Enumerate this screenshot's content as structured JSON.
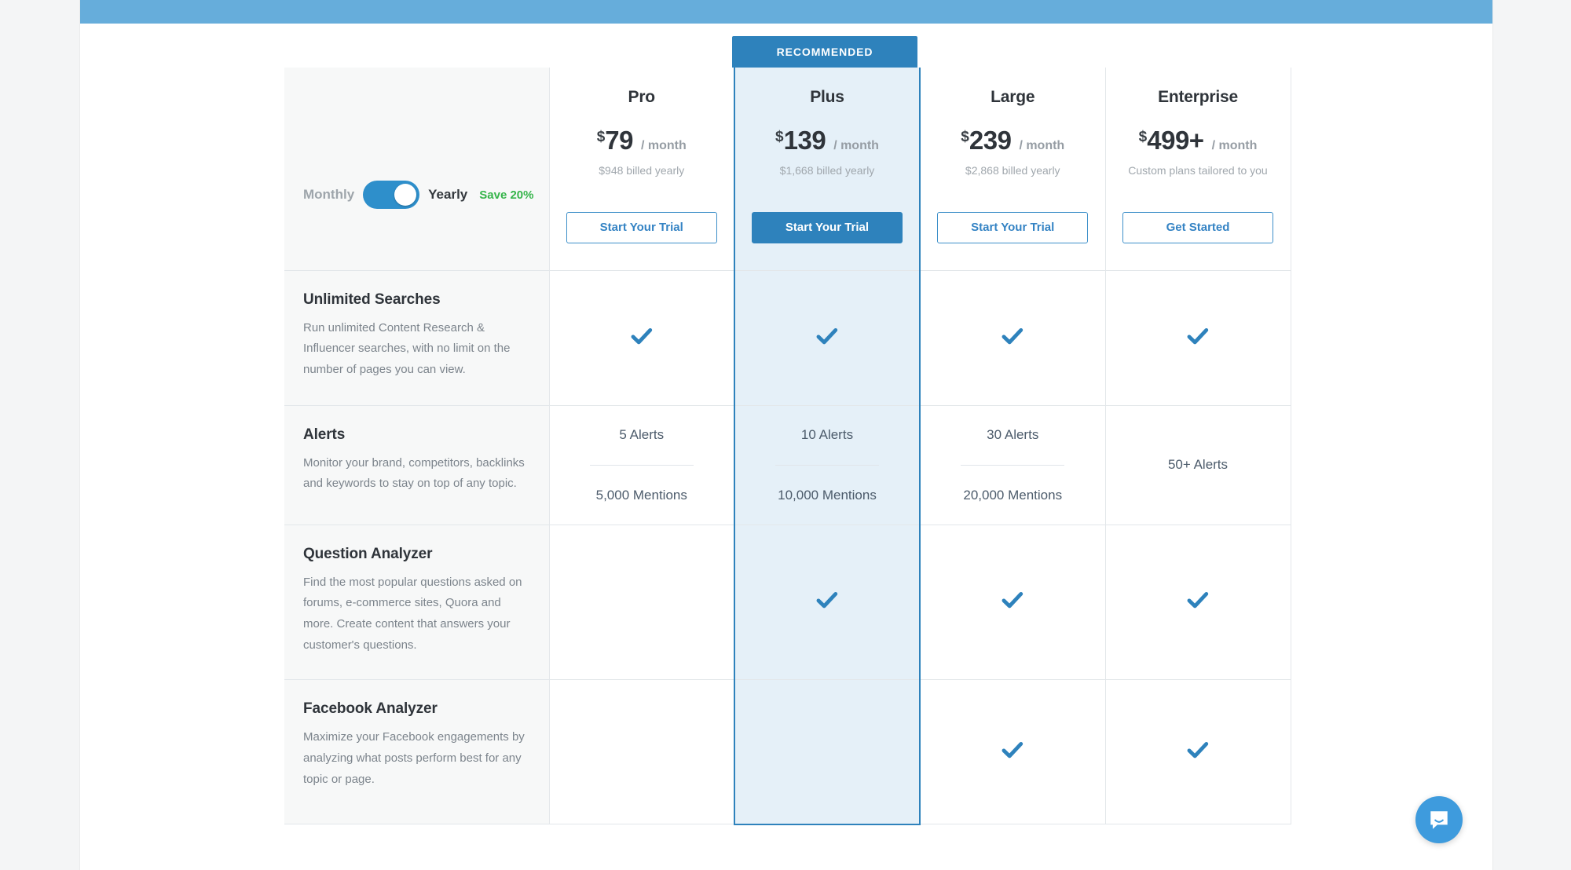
{
  "theme": {
    "top_bar_color": "#66ADDB",
    "accent_color": "#2E82BC",
    "highlight_bg": "#e5f0f8",
    "save_color": "#35b44a"
  },
  "billing_toggle": {
    "monthly_label": "Monthly",
    "yearly_label": "Yearly",
    "save_label": "Save 20%",
    "selected": "Yearly"
  },
  "recommended_badge": "RECOMMENDED",
  "plans": [
    {
      "name": "Pro",
      "currency": "$",
      "amount": "79",
      "period": "/ month",
      "billed": "$948 billed yearly",
      "cta": "Start Your Trial",
      "recommended": false
    },
    {
      "name": "Plus",
      "currency": "$",
      "amount": "139",
      "period": "/ month",
      "billed": "$1,668 billed yearly",
      "cta": "Start Your Trial",
      "recommended": true
    },
    {
      "name": "Large",
      "currency": "$",
      "amount": "239",
      "period": "/ month",
      "billed": "$2,868 billed yearly",
      "cta": "Start Your Trial",
      "recommended": false
    },
    {
      "name": "Enterprise",
      "currency": "$",
      "amount": "499+",
      "period": "/ month",
      "billed": "Custom plans tailored to you",
      "cta": "Get Started",
      "recommended": false
    }
  ],
  "features": [
    {
      "title": "Unlimited Searches",
      "description": "Run unlimited Content Research & Influencer searches, with no limit on the number of pages you can view.",
      "values": [
        {
          "type": "check"
        },
        {
          "type": "check"
        },
        {
          "type": "check"
        },
        {
          "type": "check"
        }
      ]
    },
    {
      "title": "Alerts",
      "description": "Monitor your brand, competitors, backlinks and keywords to stay on top of any topic.",
      "values": [
        {
          "type": "stack",
          "primary": "5 Alerts",
          "secondary": "5,000 Mentions"
        },
        {
          "type": "stack",
          "primary": "10 Alerts",
          "secondary": "10,000 Mentions"
        },
        {
          "type": "stack",
          "primary": "30 Alerts",
          "secondary": "20,000 Mentions"
        },
        {
          "type": "text",
          "primary": "50+ Alerts"
        }
      ]
    },
    {
      "title": "Question Analyzer",
      "description": "Find the most popular questions asked on forums, e-commerce sites, Quora and more. Create content that answers your customer's questions.",
      "values": [
        {
          "type": "empty"
        },
        {
          "type": "check"
        },
        {
          "type": "check"
        },
        {
          "type": "check"
        }
      ]
    },
    {
      "title": "Facebook Analyzer",
      "description": "Maximize your Facebook engagements by analyzing what posts perform best for any topic or page.",
      "values": [
        {
          "type": "empty"
        },
        {
          "type": "empty"
        },
        {
          "type": "check"
        },
        {
          "type": "check"
        }
      ]
    }
  ],
  "support_widget": {
    "icon": "chat-bubble-icon"
  }
}
